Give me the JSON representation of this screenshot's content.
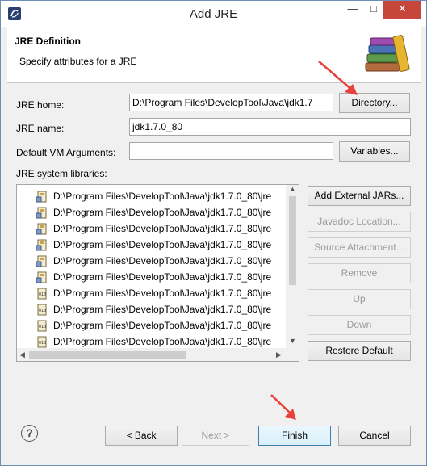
{
  "window": {
    "title": "Add JRE",
    "minimize": "—",
    "maximize": "□",
    "close": "✕"
  },
  "header": {
    "title": "JRE Definition",
    "description": "Specify attributes for a JRE"
  },
  "form": {
    "jre_home_label": "JRE home:",
    "jre_home_value": "D:\\Program Files\\DevelopTool\\Java\\jdk1.7",
    "directory_button": "Directory...",
    "jre_name_label": "JRE name:",
    "jre_name_value": "jdk1.7.0_80",
    "vm_args_label": "Default VM Arguments:",
    "vm_args_value": "",
    "variables_button": "Variables...",
    "libraries_label": "JRE system libraries:"
  },
  "libraries": [
    {
      "path": "D:\\Program Files\\DevelopTool\\Java\\jdk1.7.0_80\\jre",
      "icon": "jar-icon"
    },
    {
      "path": "D:\\Program Files\\DevelopTool\\Java\\jdk1.7.0_80\\jre",
      "icon": "jar-icon"
    },
    {
      "path": "D:\\Program Files\\DevelopTool\\Java\\jdk1.7.0_80\\jre",
      "icon": "jar-icon"
    },
    {
      "path": "D:\\Program Files\\DevelopTool\\Java\\jdk1.7.0_80\\jre",
      "icon": "jar-icon"
    },
    {
      "path": "D:\\Program Files\\DevelopTool\\Java\\jdk1.7.0_80\\jre",
      "icon": "jar-icon"
    },
    {
      "path": "D:\\Program Files\\DevelopTool\\Java\\jdk1.7.0_80\\jre",
      "icon": "jar-icon"
    },
    {
      "path": "D:\\Program Files\\DevelopTool\\Java\\jdk1.7.0_80\\jre",
      "icon": "binary-jar-icon"
    },
    {
      "path": "D:\\Program Files\\DevelopTool\\Java\\jdk1.7.0_80\\jre",
      "icon": "binary-jar-icon"
    },
    {
      "path": "D:\\Program Files\\DevelopTool\\Java\\jdk1.7.0_80\\jre",
      "icon": "binary-jar-icon"
    },
    {
      "path": "D:\\Program Files\\DevelopTool\\Java\\jdk1.7.0_80\\jre",
      "icon": "binary-jar-icon"
    }
  ],
  "side_buttons": {
    "add_external_jars": "Add External JARs...",
    "javadoc_location": "Javadoc Location...",
    "source_attachment": "Source Attachment...",
    "remove": "Remove",
    "up": "Up",
    "down": "Down",
    "restore_default": "Restore Default"
  },
  "footer": {
    "help": "?",
    "back": "< Back",
    "next": "Next >",
    "finish": "Finish",
    "cancel": "Cancel"
  },
  "colors": {
    "annotation_arrow": "#e8403a",
    "close_button": "#c7463c"
  }
}
